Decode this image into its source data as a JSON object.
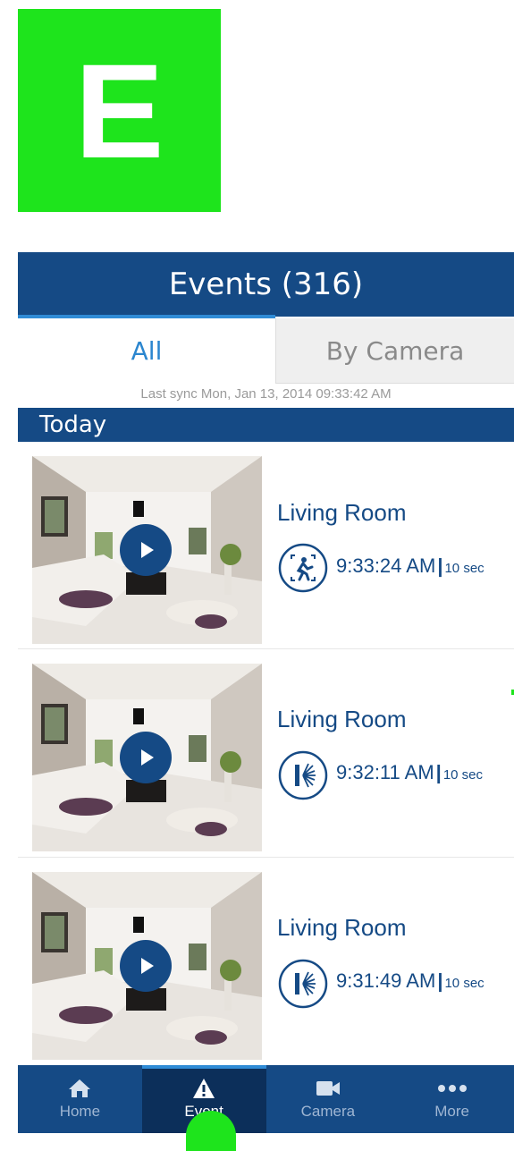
{
  "badge": {
    "letter": "E",
    "color": "#1ee41c"
  },
  "header": {
    "title": "Events (316)"
  },
  "tabs": [
    {
      "label": "All",
      "selected": true
    },
    {
      "label": "By Camera",
      "selected": false
    }
  ],
  "sync": {
    "text": "Last sync Mon, Jan 13, 2014 09:33:42 AM"
  },
  "section": {
    "label": "Today"
  },
  "events": [
    {
      "title": "Living Room",
      "icon": "motion-person-icon",
      "time": "9:33:24 AM",
      "duration": "10 sec"
    },
    {
      "title": "Living Room",
      "icon": "door-sensor-icon",
      "time": "9:32:11 AM",
      "duration": "10 sec"
    },
    {
      "title": "Living Room",
      "icon": "door-sensor-icon",
      "time": "9:31:49 AM",
      "duration": "10 sec"
    }
  ],
  "tabbar": [
    {
      "label": "Home",
      "icon": "home-icon"
    },
    {
      "label": "Event",
      "icon": "alert-icon",
      "active": true
    },
    {
      "label": "Camera",
      "icon": "video-camera-icon"
    },
    {
      "label": "More",
      "icon": "more-dots-icon"
    }
  ],
  "colors": {
    "primary": "#154a85",
    "accent": "#2f8bd6",
    "tab_text": "#2b86cf"
  }
}
